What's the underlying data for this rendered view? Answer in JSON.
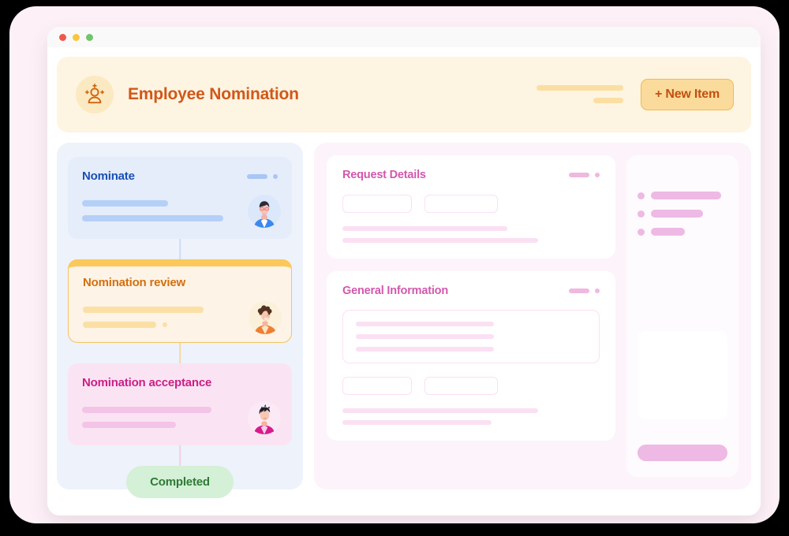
{
  "window": {
    "traffic_lights": [
      "close",
      "minimize",
      "maximize"
    ],
    "colors": {
      "close": "#f0584a",
      "minimize": "#f8c63f",
      "maximize": "#73c46c"
    }
  },
  "header": {
    "icon": "add-person-sparkle-icon",
    "title": "Employee Nomination",
    "title_color": "#d15818",
    "banner_color": "#fdf4e2",
    "new_item_button": "+ New Item",
    "new_item_color": "#fbdb9c",
    "skeleton_bars": 2
  },
  "workflow": {
    "panel_color": "#eef2fb",
    "steps": [
      {
        "title": "Nominate",
        "accent": "#1a4fb4",
        "background": "#e5edfb",
        "state": "done",
        "avatar": "avatar-man-glasses-blue",
        "line_widths": [
          "44%",
          "72%"
        ],
        "has_meta": true,
        "has_line_dot": false
      },
      {
        "title": "Nomination review",
        "accent": "#d2700f",
        "background": "#fdf3e6",
        "state": "active",
        "avatar": "avatar-woman-curly-orange",
        "line_widths": [
          "62%",
          "38%"
        ],
        "has_meta": false,
        "has_line_dot": true
      },
      {
        "title": "Nomination acceptance",
        "accent": "#cc1f86",
        "background": "#fae4f4",
        "state": "pending",
        "avatar": "avatar-man-spiky-pink",
        "line_widths": [
          "66%",
          "48%"
        ],
        "has_meta": false,
        "has_line_dot": false
      }
    ],
    "status_badge": {
      "label": "Completed",
      "background": "#d4f0d6",
      "color": "#2f7a36"
    }
  },
  "forms": {
    "panel_color": "#fdf3fa",
    "cards": [
      {
        "title": "Request Details",
        "title_color": "#d258ad",
        "has_meta": true,
        "has_textarea": false,
        "field_count": 2,
        "line_widths": [
          "64%",
          "76%"
        ]
      },
      {
        "title": "General Information",
        "title_color": "#d258ad",
        "has_meta": true,
        "has_textarea": true,
        "textarea_line_widths": [
          "60%",
          "60%",
          "60%"
        ],
        "field_count": 2,
        "line_widths": [
          "76%",
          "58%"
        ]
      }
    ]
  },
  "right_rail": {
    "background": "#fefbfe",
    "items": [
      {
        "bar_width": "78%"
      },
      {
        "bar_width": "58%"
      },
      {
        "bar_width": "38%"
      }
    ],
    "preview_box": "image-placeholder",
    "action_button": "rail-action-button",
    "accent": "#eeb9e4"
  }
}
